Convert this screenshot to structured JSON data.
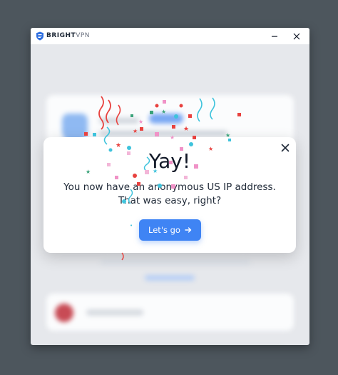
{
  "window": {
    "brand_bold": "BRIGHT",
    "brand_light": "VPN",
    "minimize_glyph": "–",
    "close_glyph": "✕"
  },
  "dialog": {
    "title": "Yay!",
    "message": "You now have an anonymous US IP address. That was easy, right?",
    "button_label": "Let's go",
    "button_icon": "arrow-right-icon"
  },
  "colors": {
    "backdrop": "#4d565d",
    "accent": "#3f84f4",
    "confetti": [
      "#e8423f",
      "#3ec3dc",
      "#f092c7",
      "#3ba37a",
      "#f3b6d8"
    ]
  }
}
